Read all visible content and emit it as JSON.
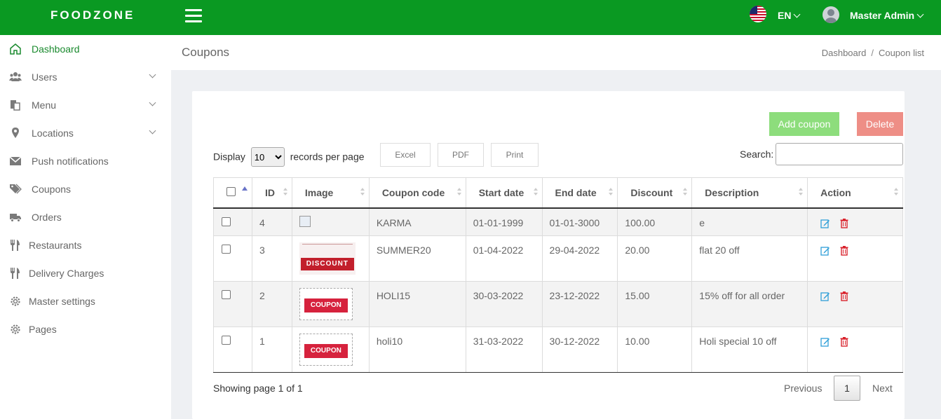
{
  "header": {
    "brand": "FOODZONE",
    "language": "EN",
    "user_name": "Master Admin"
  },
  "sidebar": {
    "items": [
      {
        "label": "Dashboard",
        "icon": "home-icon"
      },
      {
        "label": "Users",
        "icon": "users-icon"
      },
      {
        "label": "Menu",
        "icon": "menu-icon"
      },
      {
        "label": "Locations",
        "icon": "map-pin-icon"
      },
      {
        "label": "Push notifications",
        "icon": "envelope-icon"
      },
      {
        "label": "Coupons",
        "icon": "tags-icon"
      },
      {
        "label": "Orders",
        "icon": "truck-icon"
      },
      {
        "label": "Restaurants",
        "icon": "utensils-icon"
      },
      {
        "label": "Delivery Charges",
        "icon": "utensils-icon"
      },
      {
        "label": "Master settings",
        "icon": "gear-icon"
      },
      {
        "label": "Pages",
        "icon": "gear-icon"
      }
    ]
  },
  "page": {
    "title": "Coupons",
    "breadcrumb": [
      "Dashboard",
      "Coupon list"
    ]
  },
  "toolbar": {
    "add_label": "Add coupon",
    "delete_label": "Delete",
    "display_label": "Display",
    "per_page_value": "10",
    "records_label": "records per page",
    "excel_label": "Excel",
    "pdf_label": "PDF",
    "print_label": "Print",
    "search_label": "Search:",
    "search_value": ""
  },
  "table": {
    "columns": [
      "ID",
      "Image",
      "Coupon code",
      "Start date",
      "End date",
      "Discount",
      "Description",
      "Action"
    ],
    "rows": [
      {
        "id": "4",
        "image": "broken",
        "code": "KARMA",
        "start": "01-01-1999",
        "end": "01-01-3000",
        "discount": "100.00",
        "description": "e"
      },
      {
        "id": "3",
        "image": "discount",
        "code": "SUMMER20",
        "start": "01-04-2022",
        "end": "29-04-2022",
        "discount": "20.00",
        "description": "flat 20 off"
      },
      {
        "id": "2",
        "image": "coupon",
        "code": "HOLI15",
        "start": "30-03-2022",
        "end": "23-12-2022",
        "discount": "15.00",
        "description": "15% off for all order"
      },
      {
        "id": "1",
        "image": "coupon",
        "code": "holi10",
        "start": "31-03-2022",
        "end": "30-12-2022",
        "discount": "10.00",
        "description": "Holi special 10 off"
      }
    ],
    "image_text_discount": "DISCOUNT",
    "image_text_coupon": "COUPON"
  },
  "pagination": {
    "info": "Showing page 1 of 1",
    "previous": "Previous",
    "current": "1",
    "next": "Next"
  },
  "colors": {
    "topbar": "#0a9922",
    "active_nav": "#1a8a2e",
    "add_button": "#8ddd7c",
    "delete_button": "#ee8e86",
    "edit_icon": "#2f9fd8",
    "trash_icon": "#d9232d"
  }
}
